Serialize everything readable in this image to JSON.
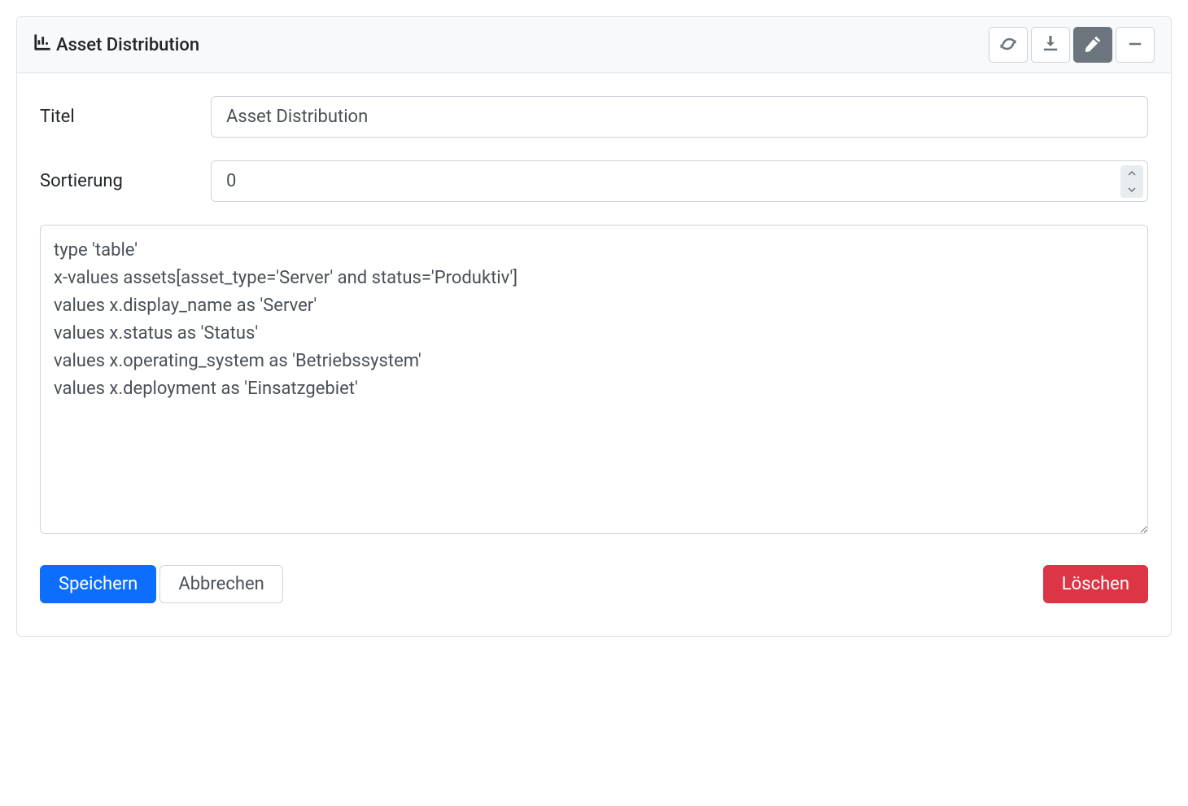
{
  "header": {
    "title": "Asset Distribution"
  },
  "form": {
    "title_label": "Titel",
    "title_value": "Asset Distribution",
    "sort_label": "Sortierung",
    "sort_value": "0",
    "code_value": "type 'table'\nx-values assets[asset_type='Server' and status='Produktiv']\nvalues x.display_name as 'Server'\nvalues x.status as 'Status'\nvalues x.operating_system as 'Betriebssystem'\nvalues x.deployment as 'Einsatzgebiet'"
  },
  "buttons": {
    "save": "Speichern",
    "cancel": "Abbrechen",
    "delete": "Löschen"
  }
}
